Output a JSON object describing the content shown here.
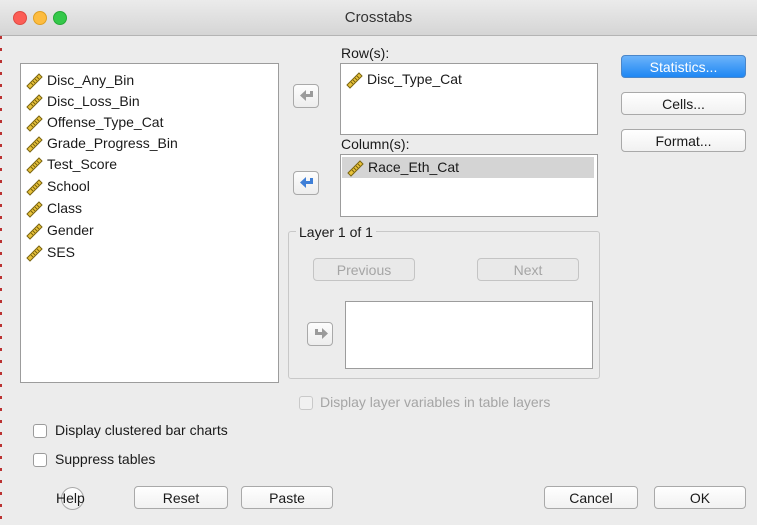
{
  "window": {
    "title": "Crosstabs"
  },
  "source_list": {
    "items": [
      {
        "label": "Disc_Any_Bin"
      },
      {
        "label": "Disc_Loss_Bin"
      },
      {
        "label": "Offense_Type_Cat"
      },
      {
        "label": "Grade_Progress_Bin"
      },
      {
        "label": "Test_Score"
      },
      {
        "label": "School"
      },
      {
        "label": "Class"
      },
      {
        "label": "Gender"
      },
      {
        "label": "SES"
      }
    ]
  },
  "rows": {
    "label": "Row(s):",
    "items": [
      {
        "label": "Disc_Type_Cat"
      }
    ]
  },
  "columns": {
    "label": "Column(s):",
    "items": [
      {
        "label": "Race_Eth_Cat",
        "selected": true
      }
    ]
  },
  "layer": {
    "title": "Layer 1 of 1",
    "previous_label": "Previous",
    "next_label": "Next"
  },
  "side_buttons": {
    "statistics": "Statistics...",
    "cells": "Cells...",
    "format": "Format..."
  },
  "options": {
    "display_layer_vars": {
      "label": "Display layer variables in table layers",
      "checked": false,
      "enabled": false
    },
    "clustered_bar": {
      "label": "Display clustered bar charts",
      "checked": false
    },
    "suppress_tables": {
      "label": "Suppress tables",
      "checked": false
    }
  },
  "footer": {
    "help": "Help",
    "reset": "Reset",
    "paste": "Paste",
    "cancel": "Cancel",
    "ok": "OK"
  },
  "icons": {
    "variable": "ruler-icon",
    "move_arrow": "arrow-left-icon",
    "layer_arrow": "arrow-right-icon"
  },
  "colors": {
    "accent": "#1e87f3",
    "selection": "#d4d4d4"
  }
}
